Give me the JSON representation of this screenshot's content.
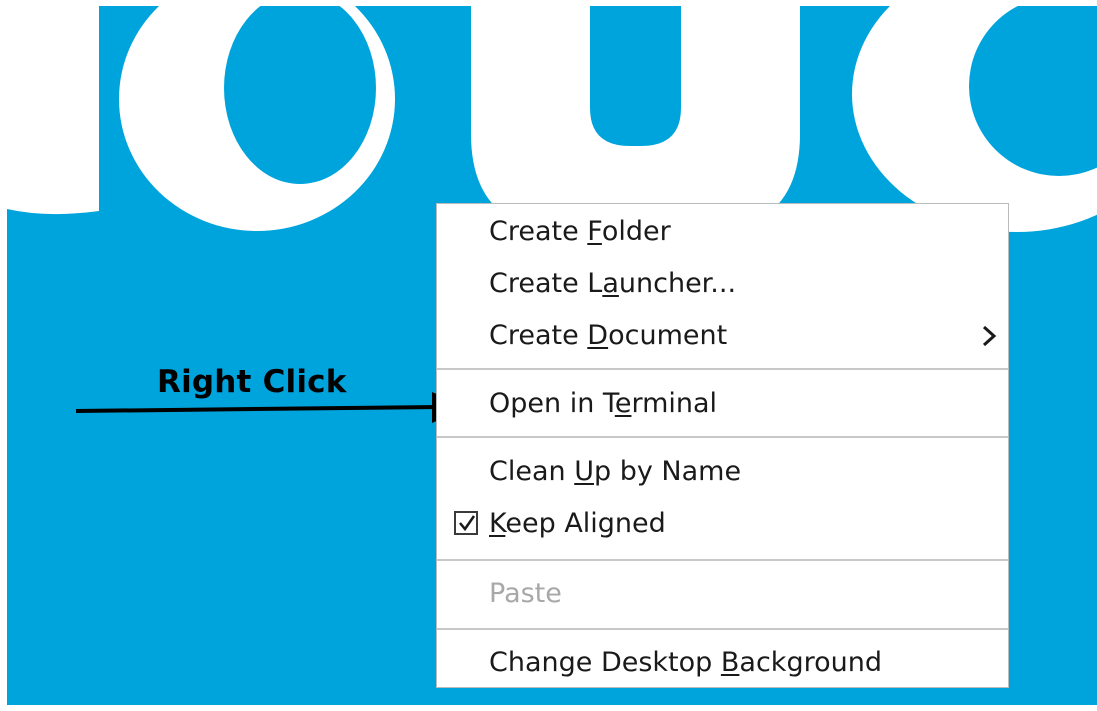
{
  "colors": {
    "wallpaper": "#00a4dc",
    "wallpaper_letters": "#ffffff",
    "menu_text": "#1a1a1a",
    "menu_disabled_text": "#a8a8a8"
  },
  "annotation": {
    "label": "Right Click",
    "icon": "arrow-right-icon"
  },
  "context_menu": {
    "items": [
      {
        "pre": "Create ",
        "mn": "F",
        "post": "older"
      },
      {
        "pre": "Create L",
        "mn": "a",
        "post": "uncher..."
      },
      {
        "pre": "Create ",
        "mn": "D",
        "post": "ocument",
        "submenu_icon": "chevron-right-icon"
      },
      {
        "pre": "Open in T",
        "mn": "e",
        "post": "rminal"
      },
      {
        "pre": "Clean ",
        "mn": "U",
        "post": "p by Name"
      },
      {
        "pre": "",
        "mn": "K",
        "post": "eep Aligned",
        "checked": true,
        "icon": "checkbox-checked-icon"
      },
      {
        "text": "Paste",
        "disabled": true
      },
      {
        "pre": "Change Desktop ",
        "mn": "B",
        "post": "ackground"
      }
    ]
  }
}
